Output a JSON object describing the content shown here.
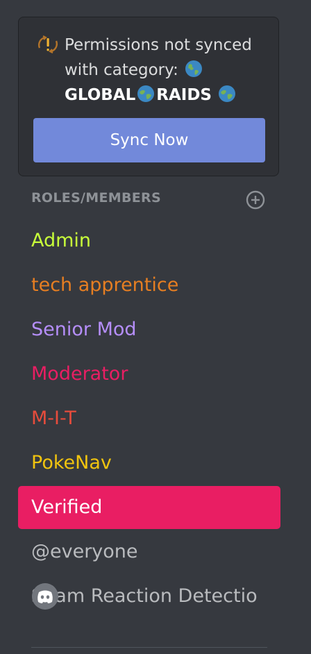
{
  "sync_notice": {
    "message": "Permissions not synced with category:",
    "category_name_part1": "GLOBAL",
    "category_name_part2": "RAIDS",
    "button_label": "Sync Now"
  },
  "roles_section": {
    "header": "ROLES/MEMBERS",
    "items": [
      {
        "label": "Admin",
        "color": "#c8ff3a"
      },
      {
        "label": "tech apprentice",
        "color": "#e67e22"
      },
      {
        "label": "Senior Mod",
        "color": "#b58ef9"
      },
      {
        "label": "Moderator",
        "color": "#e91e63"
      },
      {
        "label": "M-I-T",
        "color": "#e74c3c"
      },
      {
        "label": "PokeNav",
        "color": "#f1c40f"
      },
      {
        "label": "Verified",
        "color": "#ffffff",
        "selected": true
      },
      {
        "label": "@everyone",
        "color": "#b9bbbe"
      },
      {
        "label": "Spam Reaction Detectio",
        "color": "#b9bbbe",
        "icon": "discord-avatar-icon"
      }
    ]
  },
  "colors": {
    "background": "#36393f",
    "card": "#2f3136",
    "accent_button": "#7289da",
    "selected_row": "#e91e63"
  }
}
